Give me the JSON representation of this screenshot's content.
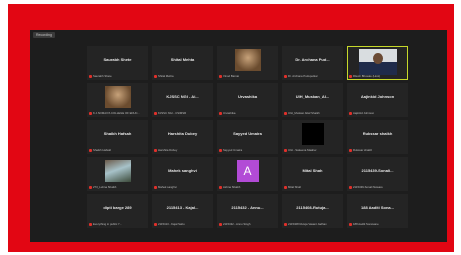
{
  "recording_label": "Recording",
  "tiles": [
    {
      "name": "Saurabh Shete",
      "label": "Saurabh Shete"
    },
    {
      "name": "Shital Mehta",
      "label": "Shital Mehta"
    },
    {
      "name": "",
      "label": "Vinod Barnai",
      "image": "photo"
    },
    {
      "name": "Dr. Archana Pud...",
      "label": "Dr. Archana Pudupetkar"
    },
    {
      "name": "",
      "label": "Ritesh Bhosale (Host)",
      "image": "self-video",
      "active": true
    },
    {
      "name": "",
      "label": "K.J.SOMAIYA COLLEGE OF EDUC...",
      "image": "photo"
    },
    {
      "name": "KJSSC NGI - Ai...",
      "label": "KJSSC NGI - CSIMSR"
    },
    {
      "name": "Urvashika",
      "label": "Urvashika"
    },
    {
      "name": "UIH_Muskan_Al...",
      "label": "UIH_Muskan Altaf Shaikh"
    },
    {
      "name": "Aajinkid Johnson",
      "label": "Aajinkid Johnson"
    },
    {
      "name": "Shaikh Hafsah",
      "label": "Shaikh Hafsah"
    },
    {
      "name": "Harshita Dubey",
      "label": "Harshita Dubey"
    },
    {
      "name": "Sayyed Umaira",
      "label": "Sayyed Umaira"
    },
    {
      "name": "",
      "label": "UIH - Sakeena Maaher",
      "image": "dark"
    },
    {
      "name": "Rukssar shaikh",
      "label": "Rukssar shaikh"
    },
    {
      "name": "",
      "label": "273_Lubna Shaikh",
      "image": "photo"
    },
    {
      "name": "Mahek sanghvi",
      "label": "Mahek sanghvi"
    },
    {
      "name": "",
      "label": "Ashna Shaikh",
      "avatar": "A"
    },
    {
      "name": "Mital Shah",
      "label": "Mital Shah"
    },
    {
      "name": "2115439-Sonali...",
      "label": "2115439-Sonali Naware"
    },
    {
      "name": "dipti barge 289",
      "label": "Everything in public 7..."
    },
    {
      "name": "2115413 - Kajal...",
      "label": "2115413 - Kajal Sahu"
    },
    {
      "name": "2115432 - Annu...",
      "label": "2115432 - Annu Singh"
    },
    {
      "name": "2115408-Rutuja...",
      "label": "2115408 Rutuja Vasant Jadhav"
    },
    {
      "name": "188 Aaditi Sona...",
      "label": "188 Aaditi Sonavane"
    }
  ]
}
